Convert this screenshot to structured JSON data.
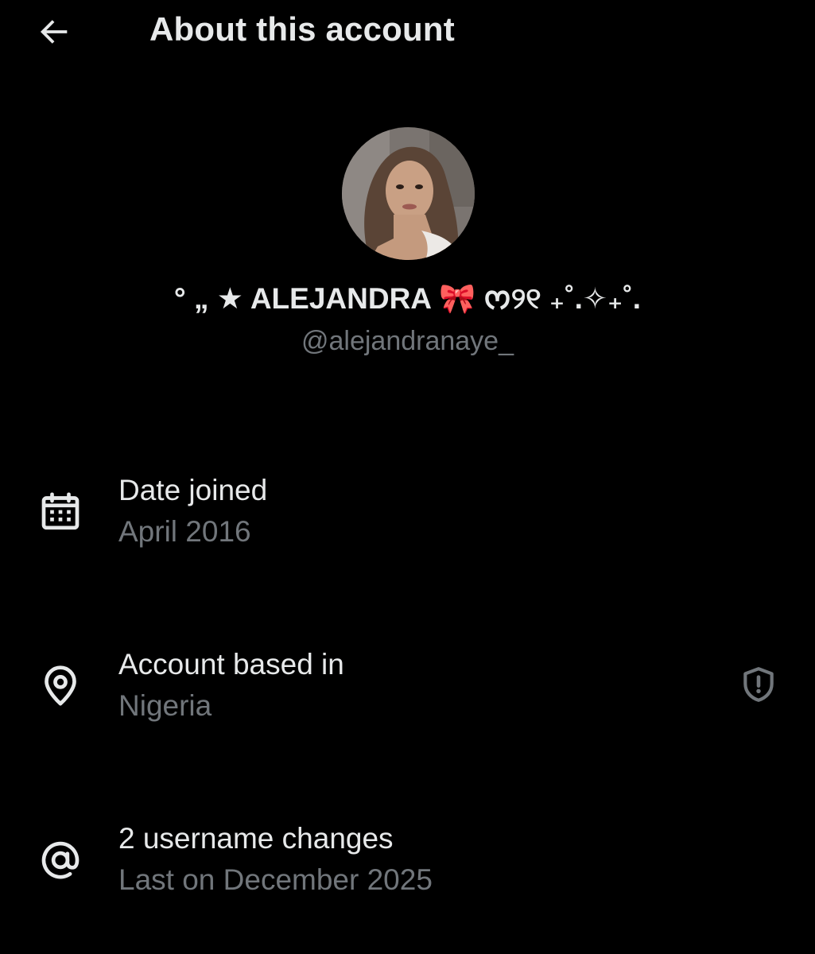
{
  "header": {
    "back_icon": "arrow-left-icon",
    "title": "About this account"
  },
  "profile": {
    "name_prefix": "° „ ★ ALEJANDRA ",
    "name_emoji": "🎀",
    "name_suffix": " ᰔ୨୧ ₊˚.✧₊˚.",
    "handle": "@alejandranaye_"
  },
  "rows": [
    {
      "icon": "calendar-icon",
      "label": "Date joined",
      "value": "April 2016"
    },
    {
      "icon": "location-pin-icon",
      "label": "Account based in",
      "value": "Nigeria",
      "action_icon": "shield-alert-icon"
    },
    {
      "icon": "at-sign-icon",
      "label": "2 username changes",
      "value": "Last on December 2025"
    }
  ],
  "colors": {
    "background": "#000000",
    "primary_text": "#e7e9ea",
    "secondary_text": "#71767b",
    "bow": "#e0475f"
  }
}
